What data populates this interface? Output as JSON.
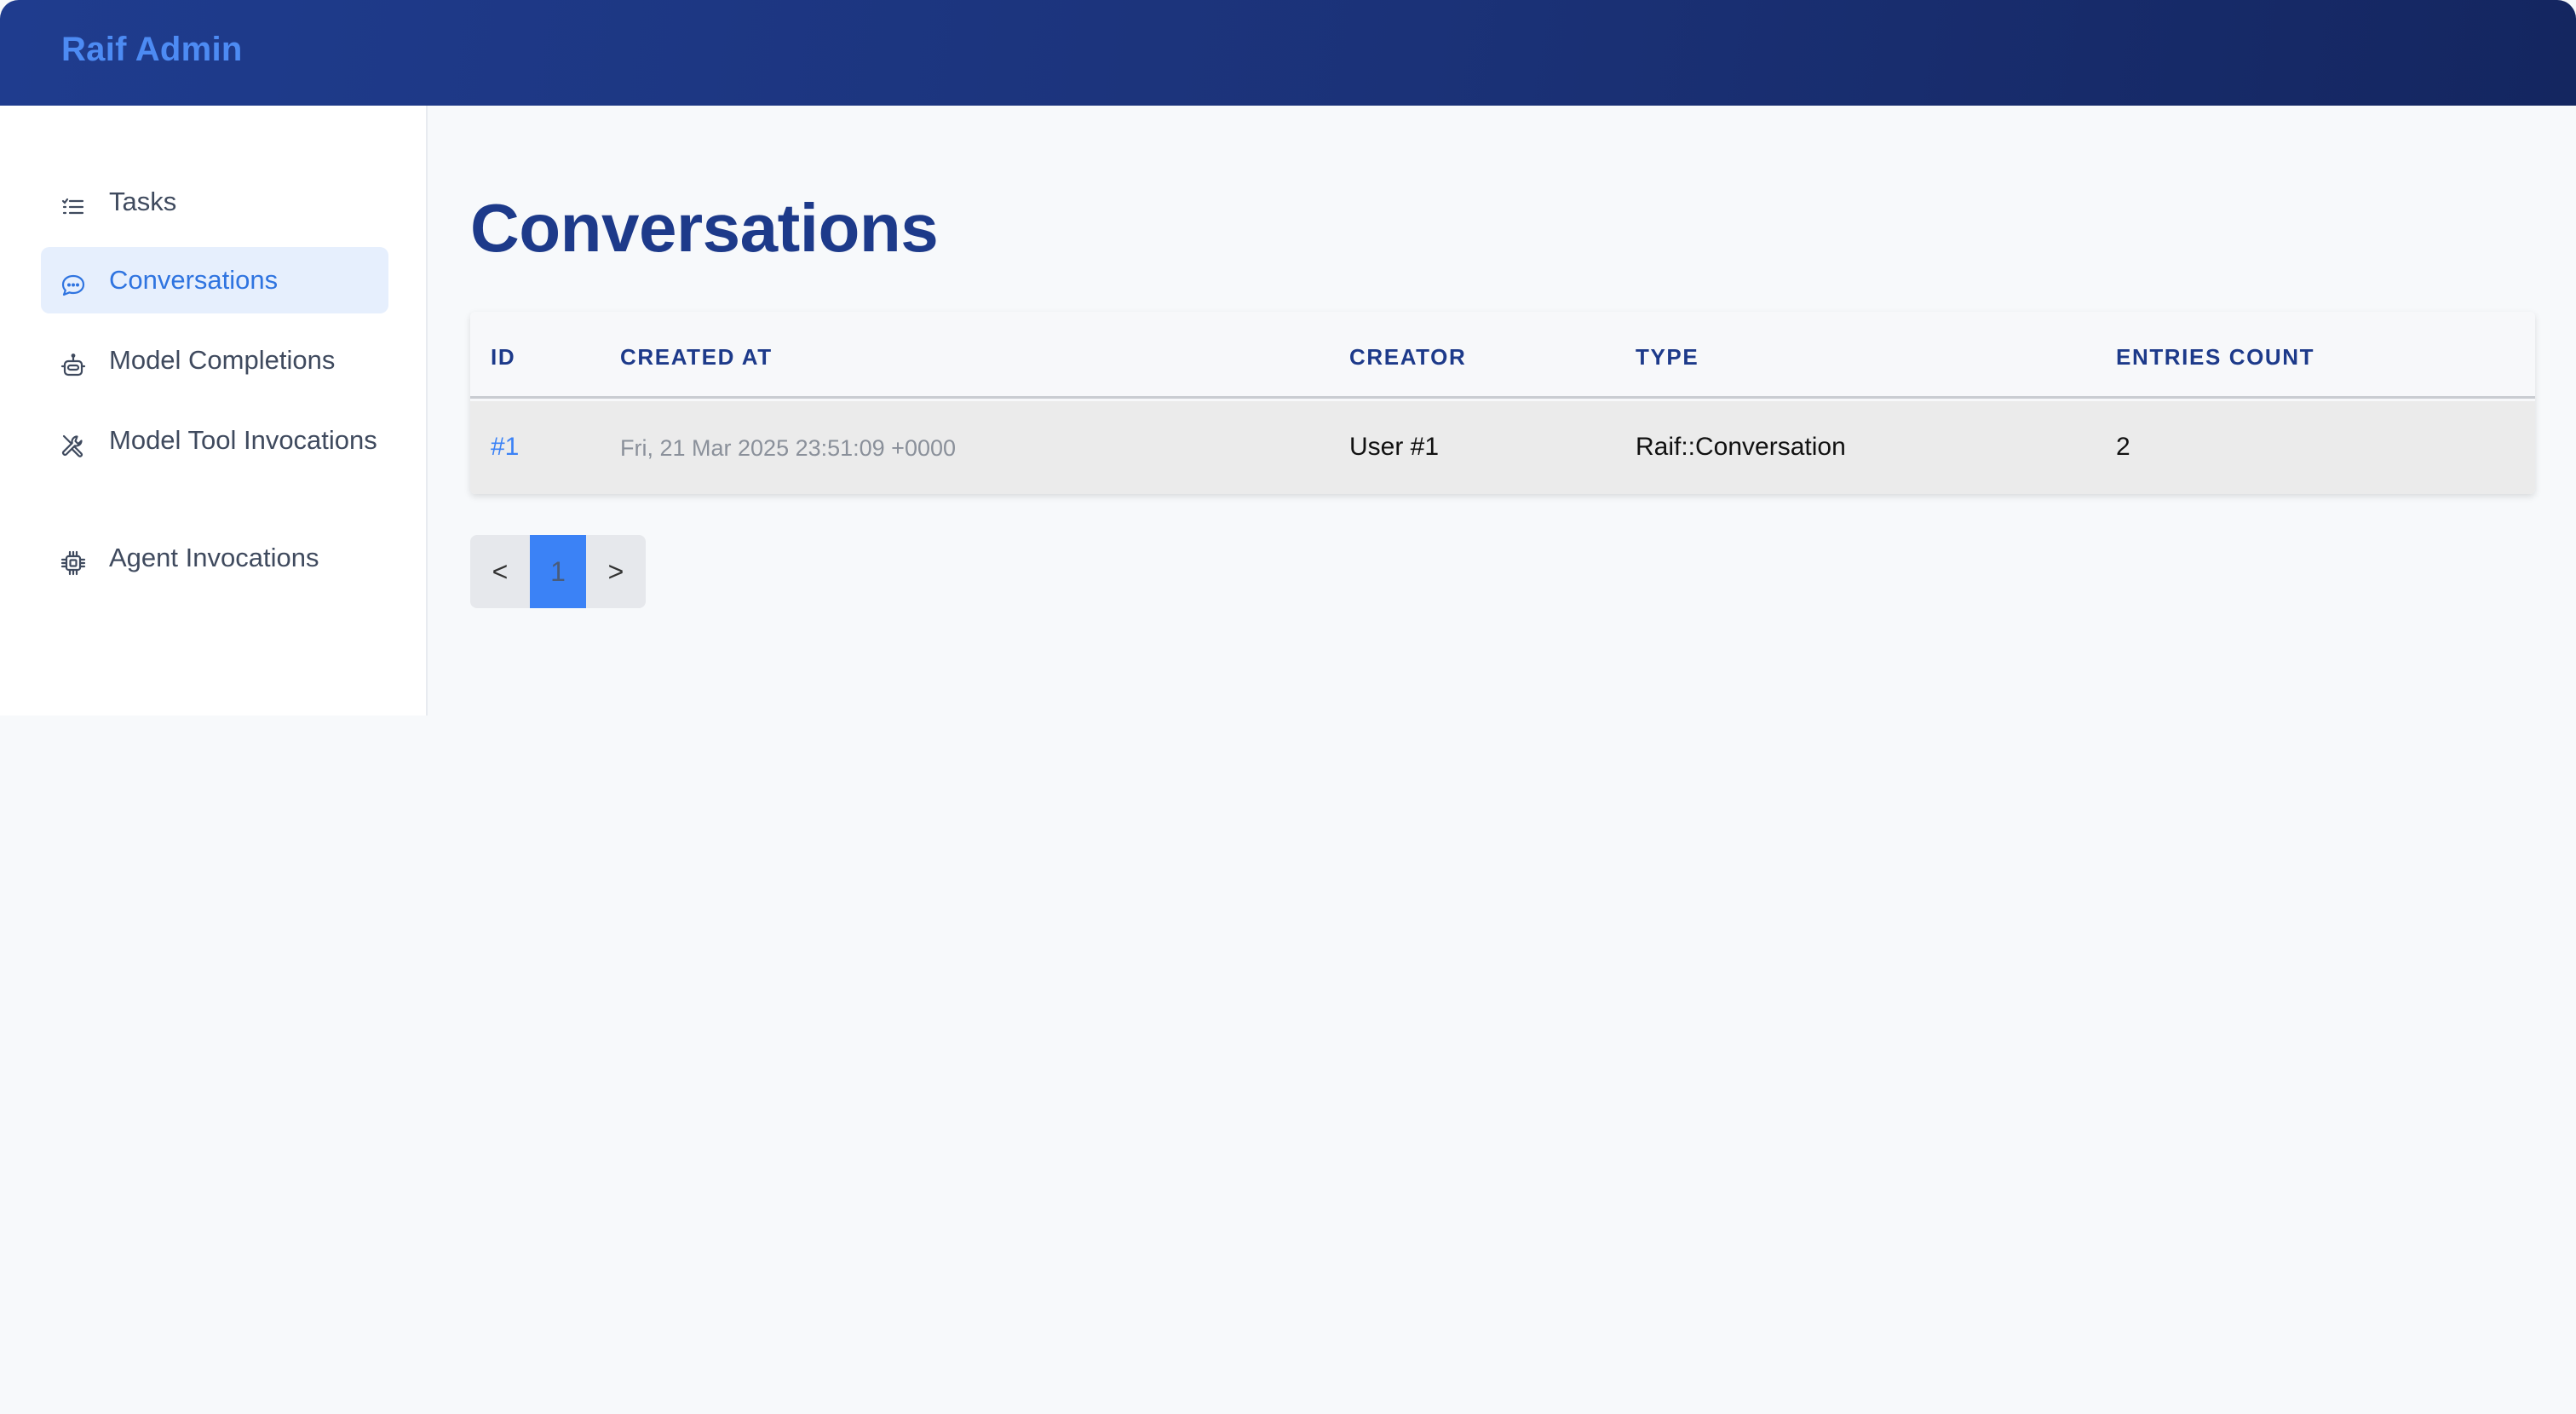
{
  "app": {
    "brand": "Raif Admin"
  },
  "sidebar": {
    "items": [
      {
        "label": "Tasks",
        "icon": "list-icon"
      },
      {
        "label": "Conversations",
        "icon": "chat-bubble-icon",
        "active": true
      },
      {
        "label": "Model Completions",
        "icon": "robot-icon"
      },
      {
        "label": "Model Tool Invocations",
        "icon": "tools-icon"
      },
      {
        "label": "Agent Invocations",
        "icon": "cpu-chip-icon"
      }
    ]
  },
  "page": {
    "title": "Conversations"
  },
  "table": {
    "columns": [
      "ID",
      "CREATED AT",
      "CREATOR",
      "TYPE",
      "ENTRIES COUNT"
    ],
    "rows": [
      {
        "id": "#1",
        "created_at": "Fri, 21 Mar 2025 23:51:09 +0000",
        "creator": "User #1",
        "type": "Raif::Conversation",
        "entries_count": "2"
      }
    ]
  },
  "pagination": {
    "prev": "<",
    "current": "1",
    "next": ">"
  },
  "colors": {
    "header_bg": "#1f3c8e",
    "brand": "#4d8bf3",
    "active_nav_bg": "#e6effd",
    "accent": "#3b82f6",
    "title": "#1d3a8a"
  }
}
